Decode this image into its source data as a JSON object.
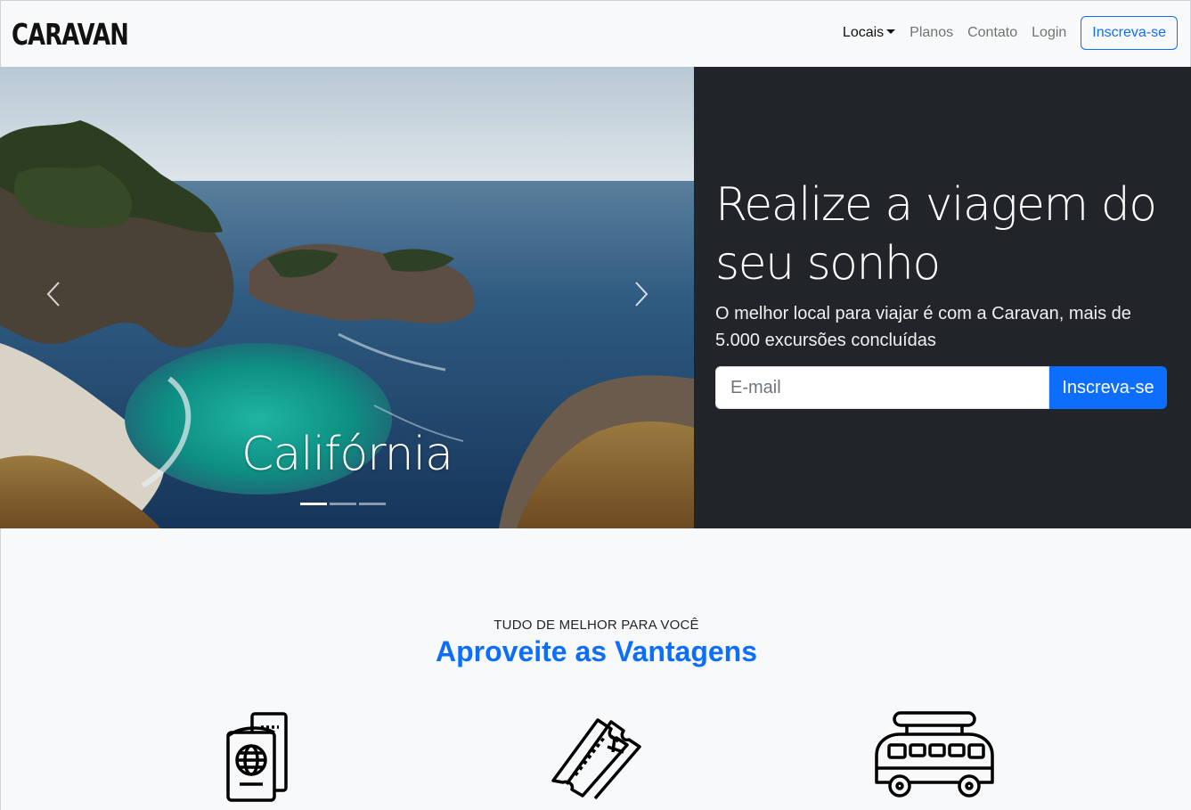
{
  "navbar": {
    "brand": "CARAVAN",
    "links": [
      "Locais",
      "Planos",
      "Contato",
      "Login"
    ],
    "signup_button": "Inscreva-se"
  },
  "carousel": {
    "slides": [
      "Califórnia"
    ],
    "active_slide": 1,
    "slide_count": 3
  },
  "hero": {
    "title": "Realize a viagem do seu sonho",
    "subtitle": "O melhor local para viajar é com a Caravan, mais de 5.000 excursões concluídas",
    "email_placeholder": "E-mail",
    "signup_button": "Inscreva-se"
  },
  "features": {
    "eyebrow": "TUDO DE MELHOR PARA VOCÊ",
    "title": "Aproveite as Vantagens",
    "items": [
      {
        "icon": "passport-icon"
      },
      {
        "icon": "plane-tickets-icon"
      },
      {
        "icon": "van-icon"
      }
    ]
  },
  "colors": {
    "primary": "#0d6efd",
    "dark": "#212529",
    "light": "#f8f9fa"
  }
}
